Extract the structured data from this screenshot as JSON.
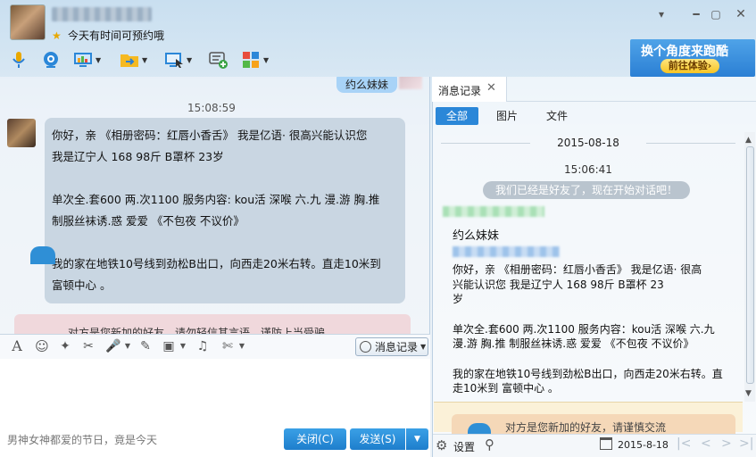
{
  "header": {
    "signature": "今天有时间可预约哦",
    "window_buttons": [
      "menu-chevron-icon",
      "minimize-icon",
      "maximize-icon",
      "close-icon"
    ]
  },
  "toolbar": {
    "icons": [
      "microphone-icon",
      "video-call-icon",
      "remote-desktop-icon",
      "file-transfer-icon",
      "screen-share-icon",
      "add-to-discussion-icon",
      "apps-grid-icon"
    ]
  },
  "ad": {
    "title": "换个角度来跑酷",
    "button": "前往体验›"
  },
  "chat": {
    "prev_message": "约么妹妹",
    "time": "15:08:59",
    "message_lines": [
      "你好，亲  《相册密码：红唇小香舌》   我是亿语· 很高兴能认识您",
      "我是辽宁人     168       98斤      B罩杯      23岁",
      "",
      "单次全.套600 两.次1100   服务内容: kou活 深喉  六.九 漫.游 胸.推",
      "制服丝袜诱.惑    爱爱     《不包夜  不议价》",
      "",
      "我的家在地铁10号线到劲松B出口，向西走20米右转。直走10米到",
      "富顿中心 。"
    ],
    "notice_text": "对方是您新加的好友，请勿轻信其言语，谨防上当受骗。"
  },
  "input_toolbar": {
    "icons": [
      "font-icon",
      "emoji-icon",
      "magic-icon",
      "screenshot-icon",
      "voice-icon",
      "edit-icon",
      "image-icon",
      "music-icon",
      "scissors-icon"
    ],
    "history_label": "消息记录"
  },
  "input": {
    "hint": "男神女神都爱的节日，竟是今天",
    "close_label": "关闭(C)",
    "send_label": "发送(S)"
  },
  "history": {
    "tab_label": "消息记录",
    "filters": [
      "全部",
      "图片",
      "文件"
    ],
    "date": "2015-08-18",
    "time": "15:06:41",
    "system_message": "我们已经是好友了，现在开始对话吧！",
    "message1": "约么妹妹",
    "message2_lines": [
      "你好，亲  《相册密码：红唇小香舌》   我是亿语· 很高",
      "兴能认识您   我是辽宁人     168      98斤     B罩杯     23",
      "岁",
      "",
      "单次全.套600 两.次1100   服务内容：kou活 深喉   六.九",
      "漫.游 胸.推 制服丝袜诱.惑     爱爱     《不包夜  不议价》",
      "",
      "我的家在地铁10号线到劲松B出口，向西走20米右转。直",
      "走10米到   富顿中心 。"
    ],
    "notice_text": "对方是您新加的好友，请谨慎交流"
  },
  "history_footer": {
    "settings_label": "设置",
    "current_date": "2015-8-18"
  }
}
